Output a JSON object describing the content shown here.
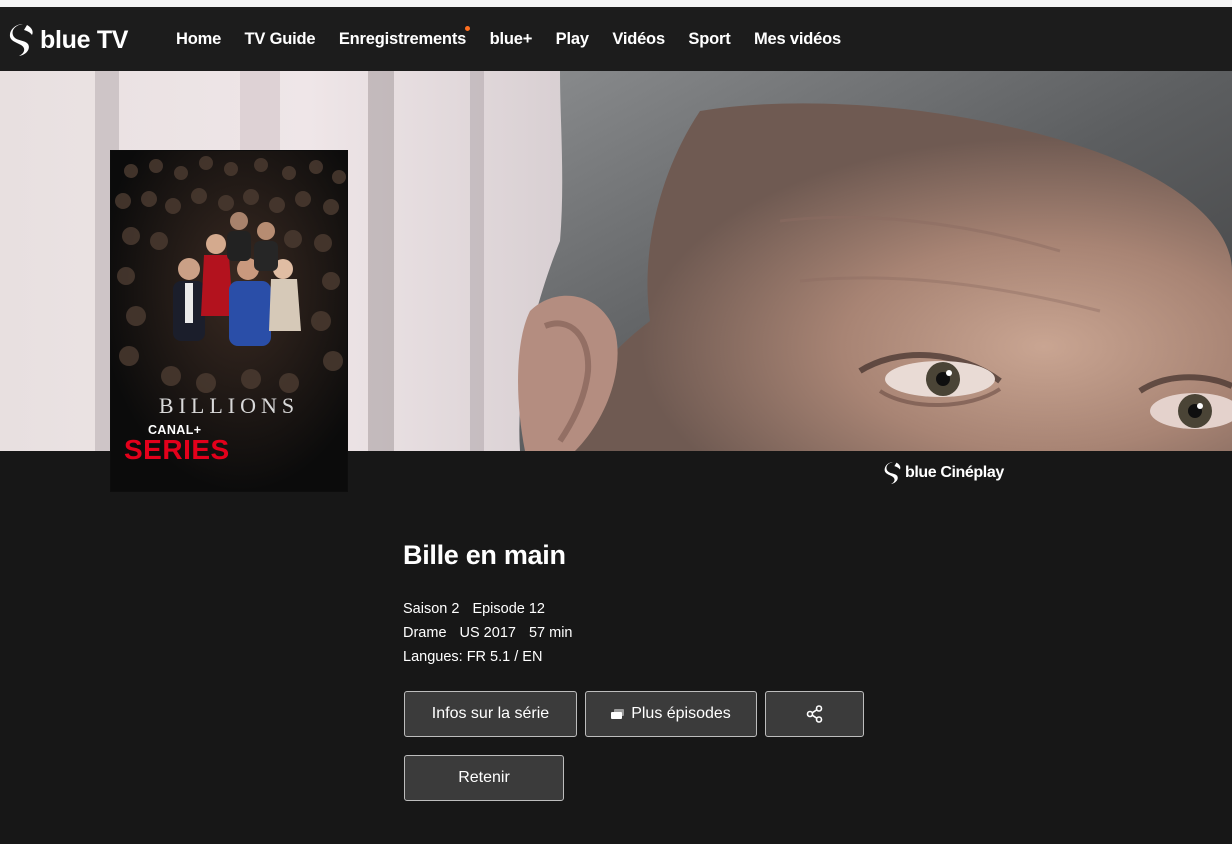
{
  "brand": {
    "logo_text": "blue TV"
  },
  "nav": {
    "items": [
      "Home",
      "TV Guide",
      "Enregistrements",
      "blue+",
      "Play",
      "Vidéos",
      "Sport",
      "Mes vidéos"
    ]
  },
  "poster": {
    "title": "BILLIONS",
    "channel": "CANAL+",
    "channel_sub": "SERIES"
  },
  "partner": {
    "label": "blue Cinéplay"
  },
  "episode": {
    "title": "Bille en main",
    "season": "Saison 2",
    "episode": "Episode 12",
    "genre": "Drame",
    "country_year": "US 2017",
    "duration": "57 min",
    "languages": "Langues: FR 5.1 / EN"
  },
  "actions": {
    "info_label": "Infos sur la série",
    "episodes_label": "Plus épisodes",
    "retain_label": "Retenir"
  },
  "icons": {
    "logo": "blue-tv-logo-icon",
    "episodes": "stack-icon",
    "share": "share-icon",
    "partner": "blue-logo-icon"
  },
  "colors": {
    "background": "#171717",
    "navbar": "#1c1c1c",
    "notification_dot": "#ff6f1f",
    "series_red": "#e3001b",
    "button_bg": "#3b3b3b"
  }
}
